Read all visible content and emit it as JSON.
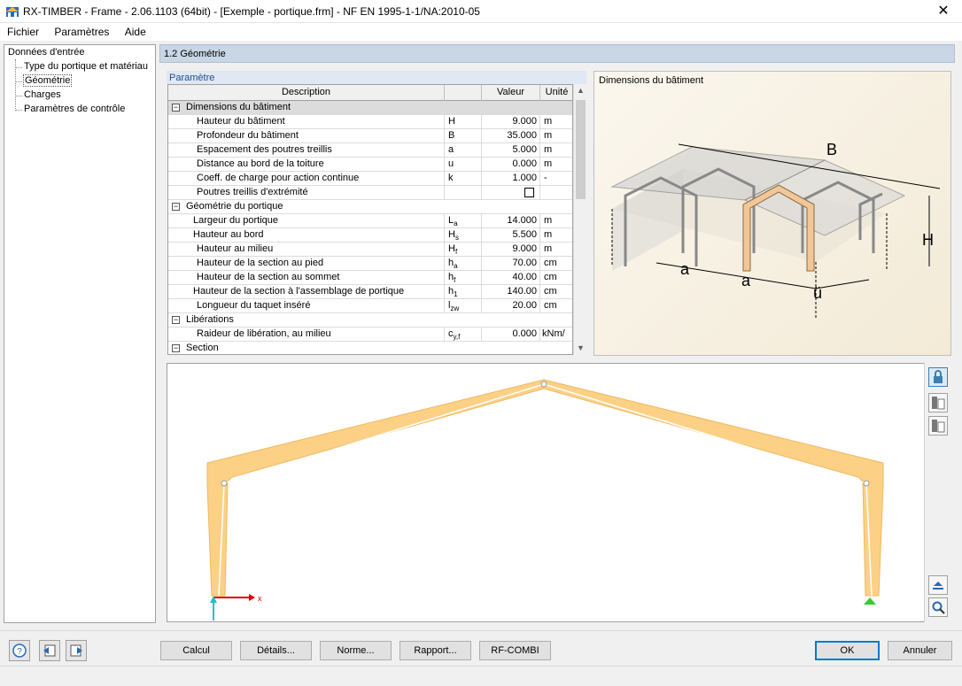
{
  "window": {
    "title": "RX-TIMBER - Frame - 2.06.1103 (64bit) - [Exemple - portique.frm] - NF EN 1995-1-1/NA:2010-05",
    "close_glyph": "✕"
  },
  "menu": {
    "file": "Fichier",
    "settings": "Paramètres",
    "help": "Aide"
  },
  "tree": {
    "root": "Données d'entrée",
    "items": [
      "Type du portique et matériau",
      "Géométrie",
      "Charges",
      "Paramètres de contrôle"
    ],
    "selected": "Géométrie"
  },
  "section": {
    "title": "1.2 Géométrie"
  },
  "params": {
    "tab": "Paramètre",
    "headers": {
      "description": "Description",
      "symbol": "",
      "value": "Valeur",
      "unit": "Unité"
    },
    "groups": [
      {
        "label": "Dimensions du bâtiment",
        "toggle": "−"
      },
      {
        "label": "Géométrie du portique",
        "toggle": "−"
      },
      {
        "label": "Libérations",
        "toggle": "−"
      },
      {
        "label": "Section",
        "toggle": "−"
      }
    ],
    "rows": [
      {
        "desc": "Hauteur du bâtiment",
        "sym": "H",
        "sub": "",
        "value": "9.000",
        "unit": "m"
      },
      {
        "desc": "Profondeur du bâtiment",
        "sym": "B",
        "sub": "",
        "value": "35.000",
        "unit": "m"
      },
      {
        "desc": "Espacement des poutres treillis",
        "sym": "a",
        "sub": "",
        "value": "5.000",
        "unit": "m"
      },
      {
        "desc": "Distance au bord de la toiture",
        "sym": "u",
        "sub": "",
        "value": "0.000",
        "unit": "m"
      },
      {
        "desc": "Coeff. de charge pour action continue",
        "sym": "k",
        "sub": "",
        "value": "1.000",
        "unit": "-"
      },
      {
        "desc": "Poutres treillis d'extrémité",
        "sym": "",
        "sub": "",
        "value": "",
        "unit": ""
      },
      {
        "desc": "Largeur du portique",
        "sym": "L",
        "sub": "a",
        "value": "14.000",
        "unit": "m"
      },
      {
        "desc": "Hauteur au bord",
        "sym": "H",
        "sub": "s",
        "value": "5.500",
        "unit": "m"
      },
      {
        "desc": "Hauteur au milieu",
        "sym": "H",
        "sub": "f",
        "value": "9.000",
        "unit": "m"
      },
      {
        "desc": "Hauteur de la section au pied",
        "sym": "h",
        "sub": "a",
        "value": "70.00",
        "unit": "cm"
      },
      {
        "desc": "Hauteur de la section au sommet",
        "sym": "h",
        "sub": "f",
        "value": "40.00",
        "unit": "cm"
      },
      {
        "desc": "Hauteur de la section à l'assemblage de portique",
        "sym": "h",
        "sub": "1",
        "value": "140.00",
        "unit": "cm"
      },
      {
        "desc": "Longueur du taquet inséré",
        "sym": "l",
        "sub": "zw",
        "value": "20.00",
        "unit": "cm"
      },
      {
        "desc": "Raideur de libération, au milieu",
        "sym": "c",
        "sub": "y,f",
        "value": "0.000",
        "unit": "kNm/"
      }
    ]
  },
  "image": {
    "caption": "Dimensions du bâtiment",
    "labels": {
      "b": "B",
      "h": "H",
      "a1": "a",
      "a2": "a",
      "u": "ü"
    }
  },
  "view": {
    "axis_x": "x"
  },
  "buttons": {
    "calc": "Calcul",
    "details": "Détails...",
    "norm": "Norme...",
    "report": "Rapport...",
    "rfcombi": "RF-COMBI",
    "ok": "OK",
    "cancel": "Annuler"
  },
  "icons": {
    "help": "?",
    "lock": "lock-icon",
    "export": "export-icon",
    "import": "import-icon",
    "prev": "prev-icon",
    "next": "next-icon"
  },
  "colors": {
    "timber": "#fcd186",
    "header_blue": "#c8d6e5",
    "accent": "#0078d7"
  }
}
